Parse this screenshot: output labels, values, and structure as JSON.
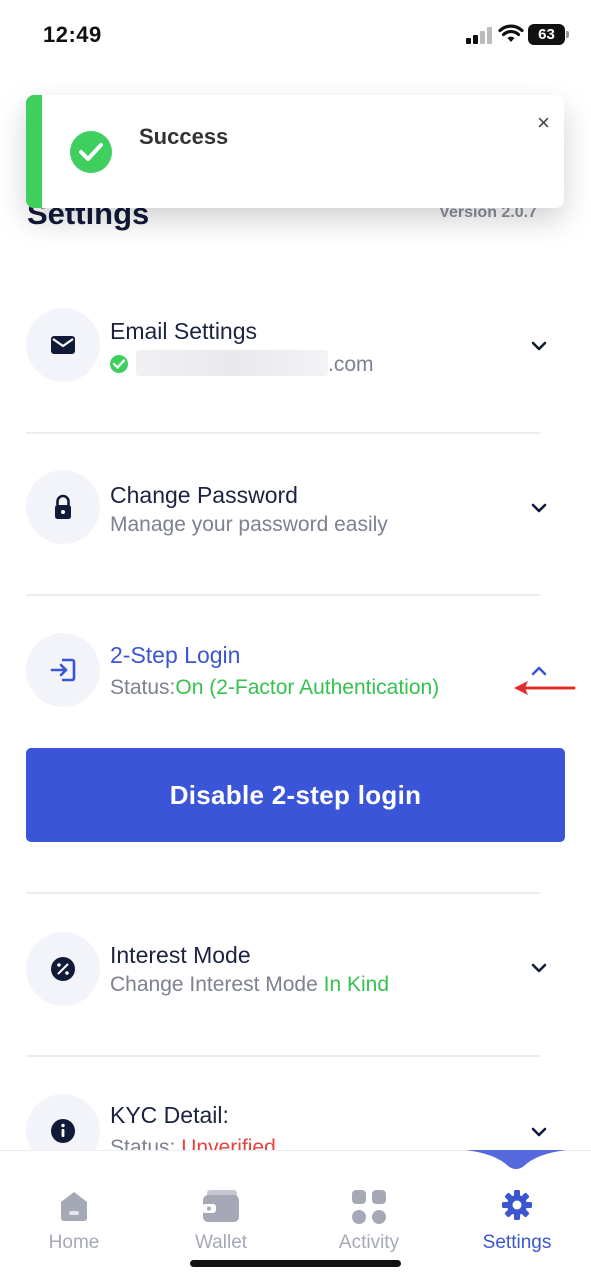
{
  "status_bar": {
    "time": "12:49",
    "battery": "63"
  },
  "toast": {
    "title": "Success",
    "close_glyph": "×",
    "icon": "check-circle-icon",
    "accent": "#3fcf5f"
  },
  "header": {
    "title": "Settings",
    "version": "Version 2.0.7"
  },
  "settings": {
    "email": {
      "title": "Email Settings",
      "domain": ".com",
      "icon": "mail-icon"
    },
    "password": {
      "title": "Change Password",
      "subtitle": "Manage your password easily",
      "icon": "lock-icon"
    },
    "two_step": {
      "title": "2-Step Login",
      "status_label": "Status:",
      "status_value": "On (2-Factor Authentication)",
      "icon": "login-arrow-icon",
      "expanded": true
    },
    "two_step_button": "Disable 2-step login",
    "interest": {
      "title": "Interest Mode",
      "subtitle": "Change Interest Mode",
      "mode_value": "In Kind",
      "icon": "percent-icon"
    },
    "kyc": {
      "title": "KYC Detail:",
      "status_label": "Status:",
      "status_value": "Unverified",
      "icon": "info-icon"
    }
  },
  "bottom_nav": {
    "items": [
      {
        "label": "Home",
        "icon": "home-icon"
      },
      {
        "label": "Wallet",
        "icon": "wallet-icon"
      },
      {
        "label": "Activity",
        "icon": "grid-icon"
      },
      {
        "label": "Settings",
        "icon": "gear-icon",
        "active": true
      }
    ]
  },
  "colors": {
    "primary": "#3b55d8",
    "success": "#36c24e",
    "danger": "#e8413d",
    "muted": "#7d8190"
  }
}
